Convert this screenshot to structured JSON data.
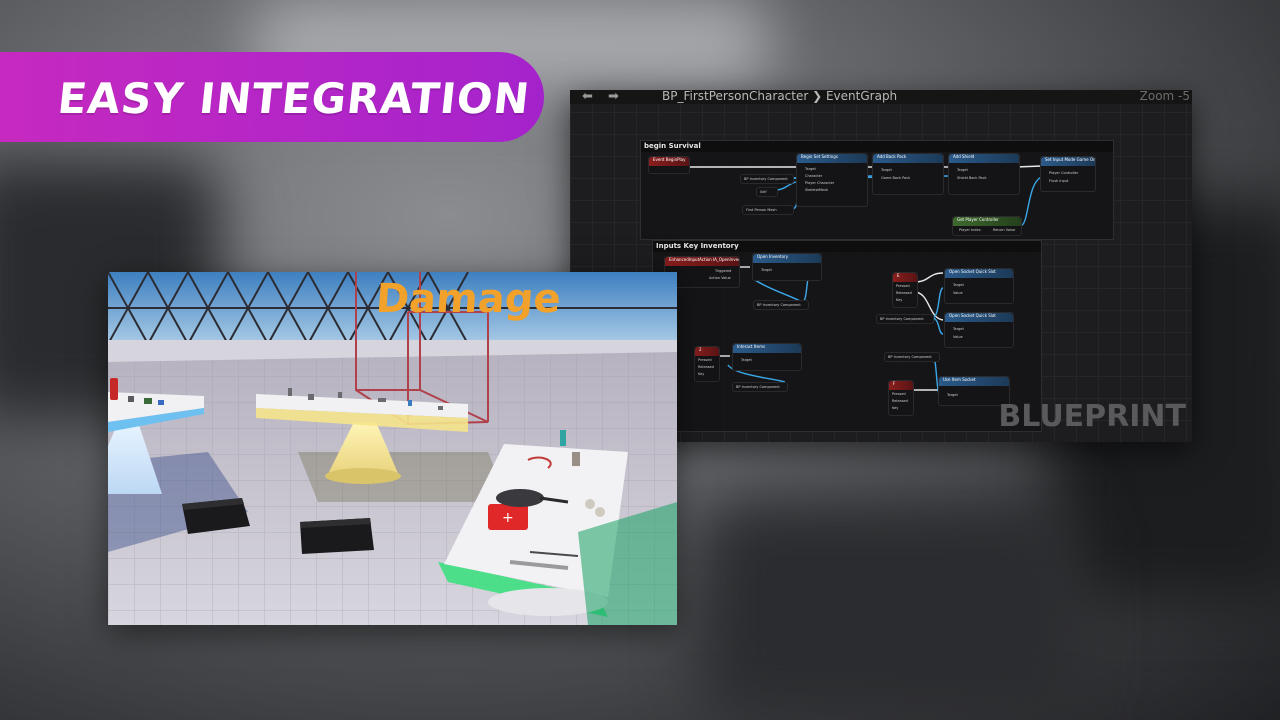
{
  "banner": {
    "title": "EASY INTEGRATION"
  },
  "blueprint": {
    "breadcrumb_back": "⬅",
    "breadcrumb_forward": "➡",
    "breadcrumb": "BP_FirstPersonCharacter ❯ EventGraph",
    "zoom": "Zoom -5",
    "watermark": "BLUEPRINT",
    "comments": [
      {
        "title": "begin Survival"
      },
      {
        "title": "Inputs Key Inventory"
      }
    ],
    "nodes": {
      "event_beginplay": "Event BeginPlay",
      "begin_set_settings": "Begin Set Settings",
      "add_back_pack": "Add Back Pack",
      "add_shield": "Add Shield",
      "set_input_mode": "Set Input Mode Game Only",
      "get_player_controller": "Get Player Controller",
      "inventory_component": "BP Inventory Component",
      "self": "Self",
      "first_person_mesh": "First Person Mesh",
      "enhanced_input": "EnhancedInputAction IA_OpenInventory",
      "open_inventory": "Open Inventory",
      "open_socket_left": "Open Socket Quick Slot",
      "open_socket_right": "Open Socket Quick Slot",
      "interact_items": "Interact Items",
      "use_item_socket": "Use Item Socket",
      "key_e": "E",
      "key_1": "1",
      "key_2": "2",
      "key_f": "F"
    },
    "pins": {
      "target": "Target",
      "character": "Character",
      "player_character": "Player Character",
      "skeletal_mesh": "SkeletalMesh",
      "game_back_pack": "Game Back Pack",
      "shield_back_pack": "Shield Back Pack",
      "player_controller": "Player Controller",
      "flush_input": "Flush Input",
      "player_index": "Player Index",
      "return_value": "Return Value",
      "triggered": "Triggered",
      "action_value": "Action Value",
      "pressed": "Pressed",
      "released": "Released",
      "key": "Key",
      "value": "Value"
    }
  },
  "viewport": {
    "sign_text": "Damage"
  }
}
